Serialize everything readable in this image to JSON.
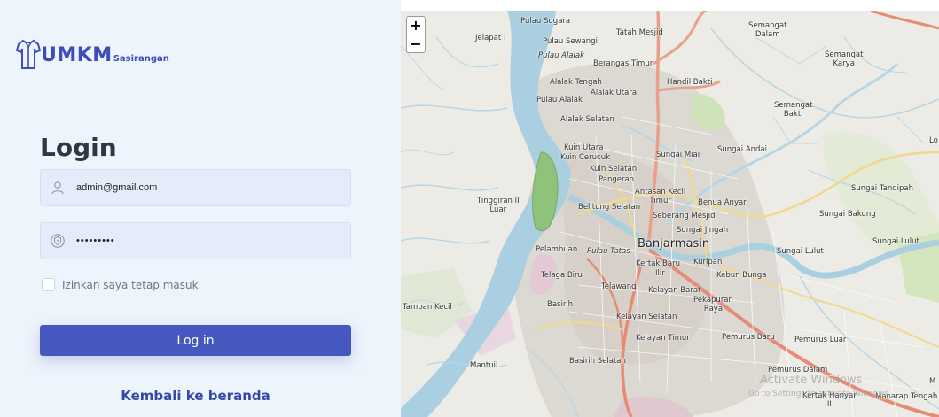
{
  "brand": {
    "name": "UMKM",
    "suffix": "Sasirangan"
  },
  "login": {
    "title": "Login",
    "email": {
      "value": "admin@gmail.com",
      "icon": "user-icon"
    },
    "password": {
      "value": "•••••••••",
      "icon": "shield-icon"
    },
    "remember_label": "Izinkan saya tetap masuk",
    "submit_label": "Log in",
    "back_label": "Kembali ke beranda"
  },
  "map": {
    "zoom_in": "+",
    "zoom_out": "−",
    "labels": {
      "pulau_sugara": "Pulau Sugara",
      "jelapat": "Jelapat I",
      "pulau_sewangi": "Pulau Sewangi",
      "tatah_mesjid": "Tatah Mesjid",
      "semangat_dalam_1": "Semangat",
      "semangat_dalam_2": "Dalam",
      "pulau_alalak": "Pulau Alalak",
      "berangas_timur": "Berangas Timur",
      "semangat_karya_1": "Semangat",
      "semangat_karya_2": "Karya",
      "alalak_tengah": "Alalak Tengah",
      "handil_bakti": "Handil Bakti",
      "alalak_utara": "Alalak Utara",
      "pulau_alalak2": "Pulau Alalak",
      "semangat_bakti_1": "Semangat",
      "semangat_bakti_2": "Bakti",
      "alalak_selatan": "Alalak Selatan",
      "sungai_andai": "Sungai Andai",
      "kuin_utara": "Kuin Utara",
      "kuin_cerucuk": "Kuin Cerucuk",
      "sungai_miai": "Sungai Miai",
      "kuin_selatan": "Kuin Selatan",
      "pangeran": "Pangeran",
      "sungai_tandipah": "Sungai Tandipah",
      "tinggiran_1": "Tinggiran II",
      "tinggiran_2": "Luar",
      "antasan_kecil_1": "Antasan Kecil",
      "antasan_kecil_2": "Timur",
      "belitung_selatan": "Belitung Selatan",
      "benua_anyar": "Benua Anyar",
      "seberang_mesjid": "Seberang Mesjid",
      "sungai_bakung": "Sungai Bakung",
      "sungai_jingah": "Sungai Jingah",
      "sungai_lulut": "Sungai Lulut",
      "pelambuan": "Pelambuan",
      "pulau_tatas": "Pulau Tatas",
      "banjarmasin": "Banjarmasin",
      "sungai_lulut2": "Sungai Lulut",
      "kertak_baru": "Kertak Baru",
      "kuripan": "Kuripan",
      "telaga_biru": "Telaga Biru",
      "ilir": "Ilir",
      "kebun_bunga": "Kebun Bunga",
      "telawang": "Telawang",
      "kelayan_barat": "Kelayan Barat",
      "tamban_kecil": "Tamban Kecil",
      "basirih": "Basirih",
      "pekapuran_1": "Pekapuran",
      "pekapuran_2": "Raya",
      "kelayan_selatan": "Kelayan Selatan",
      "kelayan_timur": "Kelayan Timur",
      "pemurus_baru": "Pemurus Baru",
      "pemurus_luar": "Pemurus Luar",
      "mantuil": "Mantuil",
      "basirih_selatan": "Basirih Selatan",
      "pemurus_dalam": "Pemurus Dalam",
      "kertak_hanyar": "Kertak Hanyar",
      "kertak_hanyar_2": "II",
      "manarap": "Manarap Tengah",
      "lo": "Lo",
      "m": "M"
    },
    "watermark": "Activate Windows",
    "watermark_sub": "Go to Settings to activate Windows."
  }
}
